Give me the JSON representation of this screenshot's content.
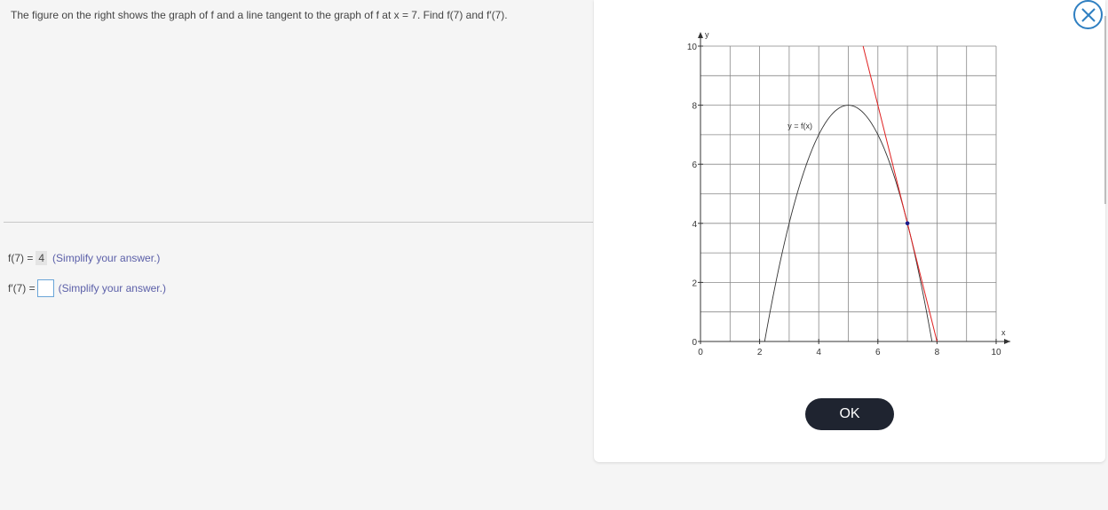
{
  "question": {
    "text": "The figure on the right shows the graph of f and a line tangent to the graph of f at x = 7. Find f(7) and f′(7)."
  },
  "answers": {
    "f7_label": "f(7) =",
    "f7_value": "4",
    "f7_hint": "(Simplify your answer.)",
    "fp7_label": "f′(7) =",
    "fp7_value": "",
    "fp7_hint": "(Simplify your answer.)"
  },
  "ok_label": "OK",
  "colors": {
    "accent": "#2f7fc1",
    "tangent": "#e02020",
    "curve": "#333333",
    "point": "#1a1a8c",
    "ok_bg": "#1f2430"
  },
  "chart_data": {
    "type": "line",
    "xlabel": "x",
    "ylabel": "y",
    "xlim": [
      0,
      10
    ],
    "ylim": [
      0,
      10
    ],
    "grid": true,
    "x_ticks": [
      "0",
      "2",
      "4",
      "6",
      "8",
      "10"
    ],
    "y_ticks": [
      "0",
      "2",
      "4",
      "6",
      "8",
      "10"
    ],
    "curve_label": "y = f(x)",
    "series": [
      {
        "name": "y = f(x)",
        "type": "parabola",
        "vertex": [
          5,
          8
        ],
        "roots": [
          2.17,
          7.83
        ]
      },
      {
        "name": "tangent",
        "type": "line",
        "points": [
          [
            5.5,
            10
          ],
          [
            8,
            0
          ]
        ]
      }
    ],
    "points": [
      [
        7,
        4
      ]
    ]
  }
}
